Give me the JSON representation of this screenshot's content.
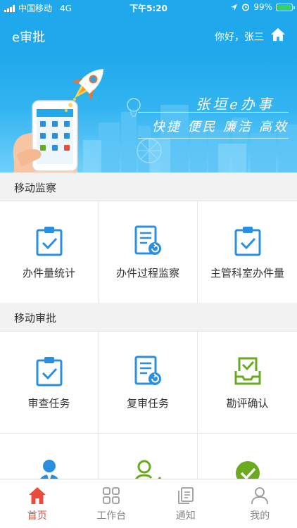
{
  "status_bar": {
    "carrier": "中国移动",
    "network": "4G",
    "time": "下午5:20",
    "battery": "99%",
    "battery_level": 0.99
  },
  "header": {
    "title": "e审批",
    "greeting": "你好，张三",
    "home_icon": "home-icon"
  },
  "banner": {
    "slogan_title": "张垣e办事",
    "slogan_sub": "快捷 便民 廉洁 高效"
  },
  "sections": [
    {
      "title": "移动监察",
      "items": [
        {
          "label": "办件量统计",
          "icon": "clipboard-check-icon"
        },
        {
          "label": "办件过程监察",
          "icon": "document-refresh-icon"
        },
        {
          "label": "主管科室办件量",
          "icon": "clipboard-check-icon"
        }
      ]
    },
    {
      "title": "移动审批",
      "items": [
        {
          "label": "审查任务",
          "icon": "clipboard-check-icon"
        },
        {
          "label": "复审任务",
          "icon": "document-refresh-icon"
        },
        {
          "label": "勘评确认",
          "icon": "inbox-check-icon"
        },
        {
          "label": "",
          "icon": "person-icon"
        },
        {
          "label": "",
          "icon": "user-check-icon"
        },
        {
          "label": "",
          "icon": "check-circle-icon"
        }
      ]
    }
  ],
  "tabbar": [
    {
      "label": "首页",
      "icon": "home-icon",
      "active": true
    },
    {
      "label": "工作台",
      "icon": "grid-icon",
      "active": false
    },
    {
      "label": "通知",
      "icon": "copy-icon",
      "active": false
    },
    {
      "label": "我的",
      "icon": "user-icon",
      "active": false
    }
  ],
  "colors": {
    "primary": "#1fa9ec",
    "icon_blue": "#2b8fe0",
    "icon_green": "#6aaa1e",
    "active_tab": "#e74c3c"
  }
}
